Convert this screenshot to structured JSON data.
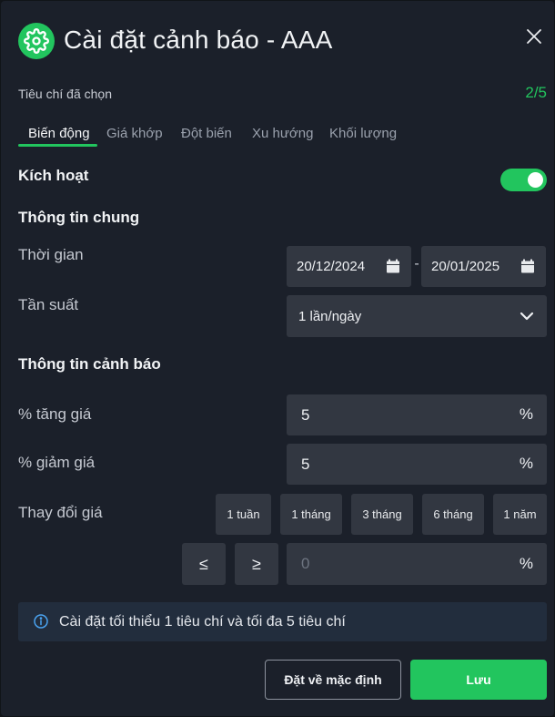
{
  "header": {
    "title": "Cài đặt cảnh báo - AAA",
    "icon": "gear-icon",
    "close_icon": "close-icon"
  },
  "criteria": {
    "label": "Tiêu chí đã chọn",
    "count": "2/5"
  },
  "tabs": [
    {
      "label": "Biến động",
      "active": true
    },
    {
      "label": "Giá khớp",
      "active": false
    },
    {
      "label": "Đột biến",
      "active": false
    },
    {
      "label": "Xu hướng",
      "active": false
    },
    {
      "label": "Khối lượng",
      "active": false
    }
  ],
  "activation": {
    "label": "Kích hoạt",
    "enabled": true
  },
  "general": {
    "title": "Thông tin chung",
    "time_label": "Thời gian",
    "date_from": "20/12/2024",
    "date_to": "20/01/2025",
    "separator": "-",
    "frequency_label": "Tần suất",
    "frequency_value": "1 lần/ngày"
  },
  "alert": {
    "title": "Thông tin cảnh báo",
    "increase_label": "% tăng giá",
    "increase_value": "5",
    "decrease_label": "% giảm giá",
    "decrease_value": "5",
    "unit": "%",
    "change_label": "Thay đổi giá",
    "periods": [
      "1 tuần",
      "1 tháng",
      "3 tháng",
      "6 tháng",
      "1 năm"
    ],
    "op_lte": "≤",
    "op_gte": "≥",
    "change_placeholder": "0"
  },
  "info": {
    "text": "Cài đặt tối thiểu 1 tiêu chí và tối đa 5 tiêu chí"
  },
  "footer": {
    "default_label": "Đặt về mặc định",
    "save_label": "Lưu"
  },
  "colors": {
    "accent": "#22c55e",
    "background": "#1b202a",
    "field": "#323741",
    "info_bg": "#222d3d"
  }
}
